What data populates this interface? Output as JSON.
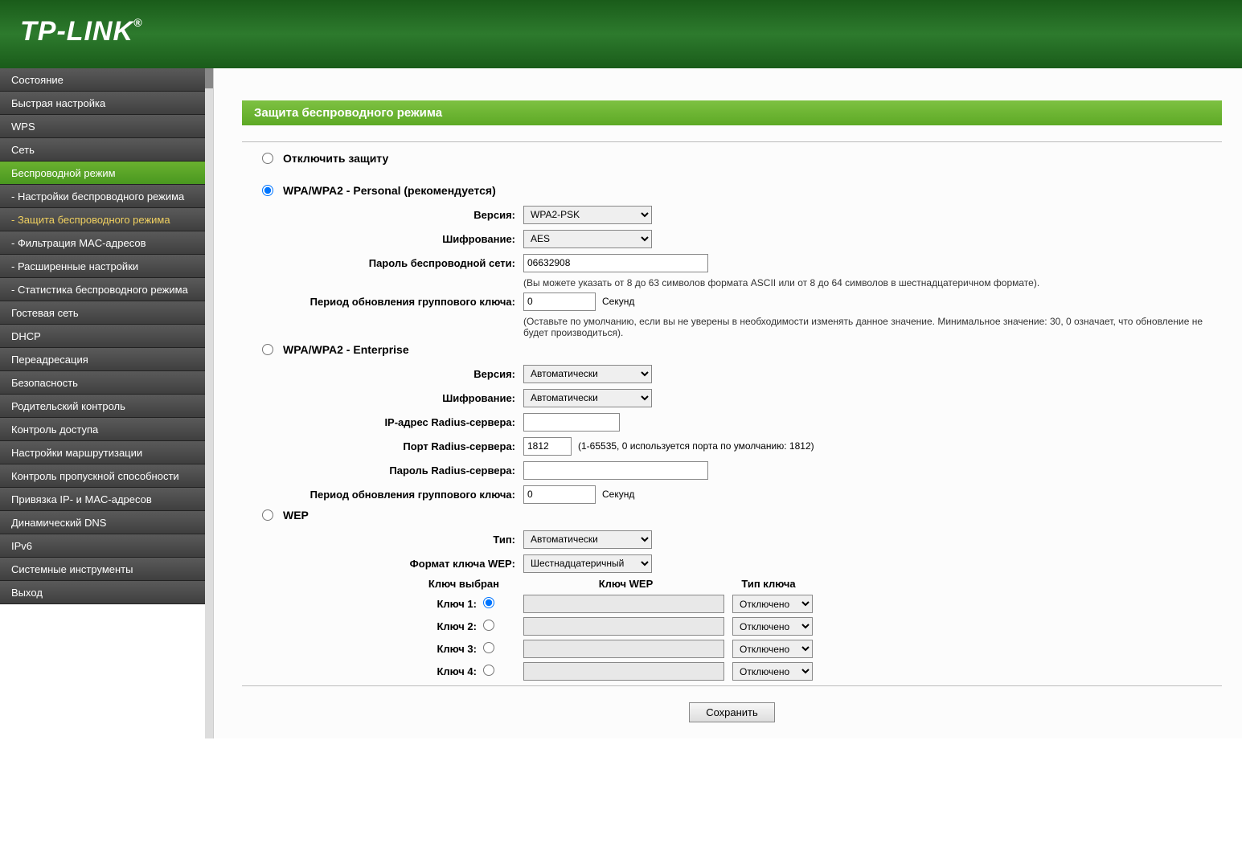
{
  "brand": "TP-LINK",
  "sidebar": {
    "items": [
      {
        "label": "Состояние"
      },
      {
        "label": "Быстрая настройка"
      },
      {
        "label": "WPS"
      },
      {
        "label": "Сеть"
      },
      {
        "label": "Беспроводной режим",
        "active": true
      },
      {
        "label": "- Настройки беспроводного режима",
        "sub": true
      },
      {
        "label": "- Защита беспроводного режима",
        "sub": true,
        "highlight": true
      },
      {
        "label": "- Фильтрация MAC-адресов",
        "sub": true
      },
      {
        "label": "- Расширенные настройки",
        "sub": true
      },
      {
        "label": "- Статистика беспроводного режима",
        "sub": true
      },
      {
        "label": "Гостевая сеть"
      },
      {
        "label": "DHCP"
      },
      {
        "label": "Переадресация"
      },
      {
        "label": "Безопасность"
      },
      {
        "label": "Родительский контроль"
      },
      {
        "label": "Контроль доступа"
      },
      {
        "label": "Настройки маршрутизации"
      },
      {
        "label": "Контроль пропускной способности"
      },
      {
        "label": "Привязка IP- и MAC-адресов"
      },
      {
        "label": "Динамический DNS"
      },
      {
        "label": "IPv6"
      },
      {
        "label": "Системные инструменты"
      },
      {
        "label": "Выход"
      }
    ]
  },
  "page": {
    "title": "Защита беспроводного режима"
  },
  "security": {
    "disable_label": "Отключить защиту",
    "selected": "personal"
  },
  "personal": {
    "title": "WPA/WPA2 - Personal (рекомендуется)",
    "version_label": "Версия:",
    "version_value": "WPA2-PSK",
    "encryption_label": "Шифрование:",
    "encryption_value": "AES",
    "password_label": "Пароль беспроводной сети:",
    "password_value": "06632908",
    "password_note": "(Вы можете указать от 8 до 63 символов формата ASCII или от 8 до 64 символов в шестнадцатеричном формате).",
    "gku_label": "Период обновления группового ключа:",
    "gku_value": "0",
    "gku_unit": "Секунд",
    "gku_note": "(Оставьте по умолчанию, если вы не уверены в необходимости изменять данное значение. Минимальное значение: 30, 0 означает, что обновление не будет производиться)."
  },
  "enterprise": {
    "title": "WPA/WPA2 - Enterprise",
    "version_label": "Версия:",
    "version_value": "Автоматически",
    "encryption_label": "Шифрование:",
    "encryption_value": "Автоматически",
    "radius_ip_label": "IP-адрес Radius-сервера:",
    "radius_ip_value": "",
    "radius_port_label": "Порт Radius-сервера:",
    "radius_port_value": "1812",
    "radius_port_note": "(1-65535, 0 используется порта по умолчанию: 1812)",
    "radius_pw_label": "Пароль Radius-сервера:",
    "radius_pw_value": "",
    "gku_label": "Период обновления группового ключа:",
    "gku_value": "0",
    "gku_unit": "Секунд"
  },
  "wep": {
    "title": "WEP",
    "type_label": "Тип:",
    "type_value": "Автоматически",
    "format_label": "Формат ключа WEP:",
    "format_value": "Шестнадцатеричный",
    "col_selected": "Ключ выбран",
    "col_key": "Ключ WEP",
    "col_type": "Тип ключа",
    "keys": [
      {
        "label": "Ключ 1:",
        "value": "",
        "type": "Отключено",
        "selected": true
      },
      {
        "label": "Ключ 2:",
        "value": "",
        "type": "Отключено",
        "selected": false
      },
      {
        "label": "Ключ 3:",
        "value": "",
        "type": "Отключено",
        "selected": false
      },
      {
        "label": "Ключ 4:",
        "value": "",
        "type": "Отключено",
        "selected": false
      }
    ]
  },
  "actions": {
    "save": "Сохранить"
  }
}
